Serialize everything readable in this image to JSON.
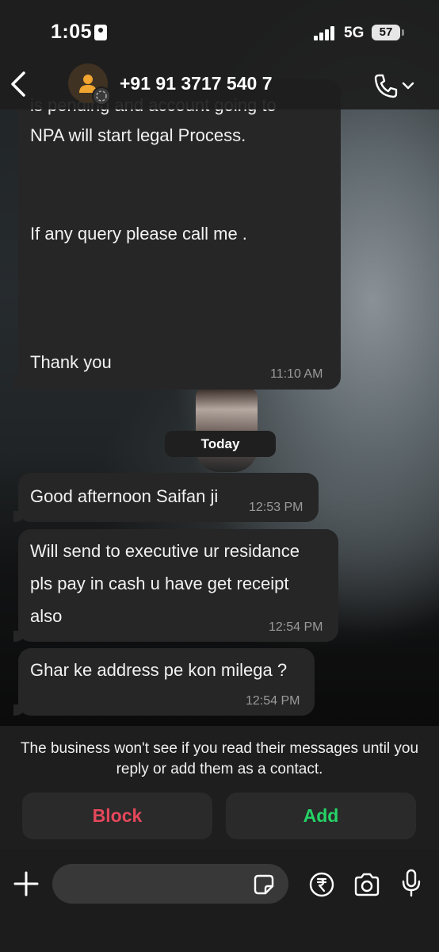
{
  "status_bar": {
    "time": "1:05",
    "network": "5G",
    "battery": "57"
  },
  "header": {
    "contact_name": "+91 91 3717 540 7"
  },
  "messages": [
    {
      "lines": [
        "is pending and account going to",
        "NPA will start legal Process.",
        "If any query please call me .",
        "Thank you"
      ],
      "time": "11:10 AM"
    },
    {
      "date_label": "Today"
    },
    {
      "lines": [
        "Good afternoon Saifan ji"
      ],
      "time": "12:53 PM"
    },
    {
      "lines": [
        "Will send to executive ur residance",
        "pls pay in cash u have get receipt",
        "also"
      ],
      "time": "12:54 PM"
    },
    {
      "lines": [
        "Ghar ke address pe kon milega ?"
      ],
      "time": "12:54 PM"
    }
  ],
  "notice": {
    "text": "The business won't see if you read their messages until you reply or add them as a contact."
  },
  "actions": {
    "block_label": "Block",
    "add_label": "Add"
  },
  "composer": {
    "value": ""
  },
  "colors": {
    "block": "#e5475b",
    "add": "#25d366",
    "bubble": "#262627"
  },
  "icons": [
    "chevron-left-icon",
    "person-icon",
    "phone-icon",
    "chevron-down-icon",
    "plus-icon",
    "sticker-icon",
    "rupee-icon",
    "camera-icon",
    "microphone-icon"
  ]
}
